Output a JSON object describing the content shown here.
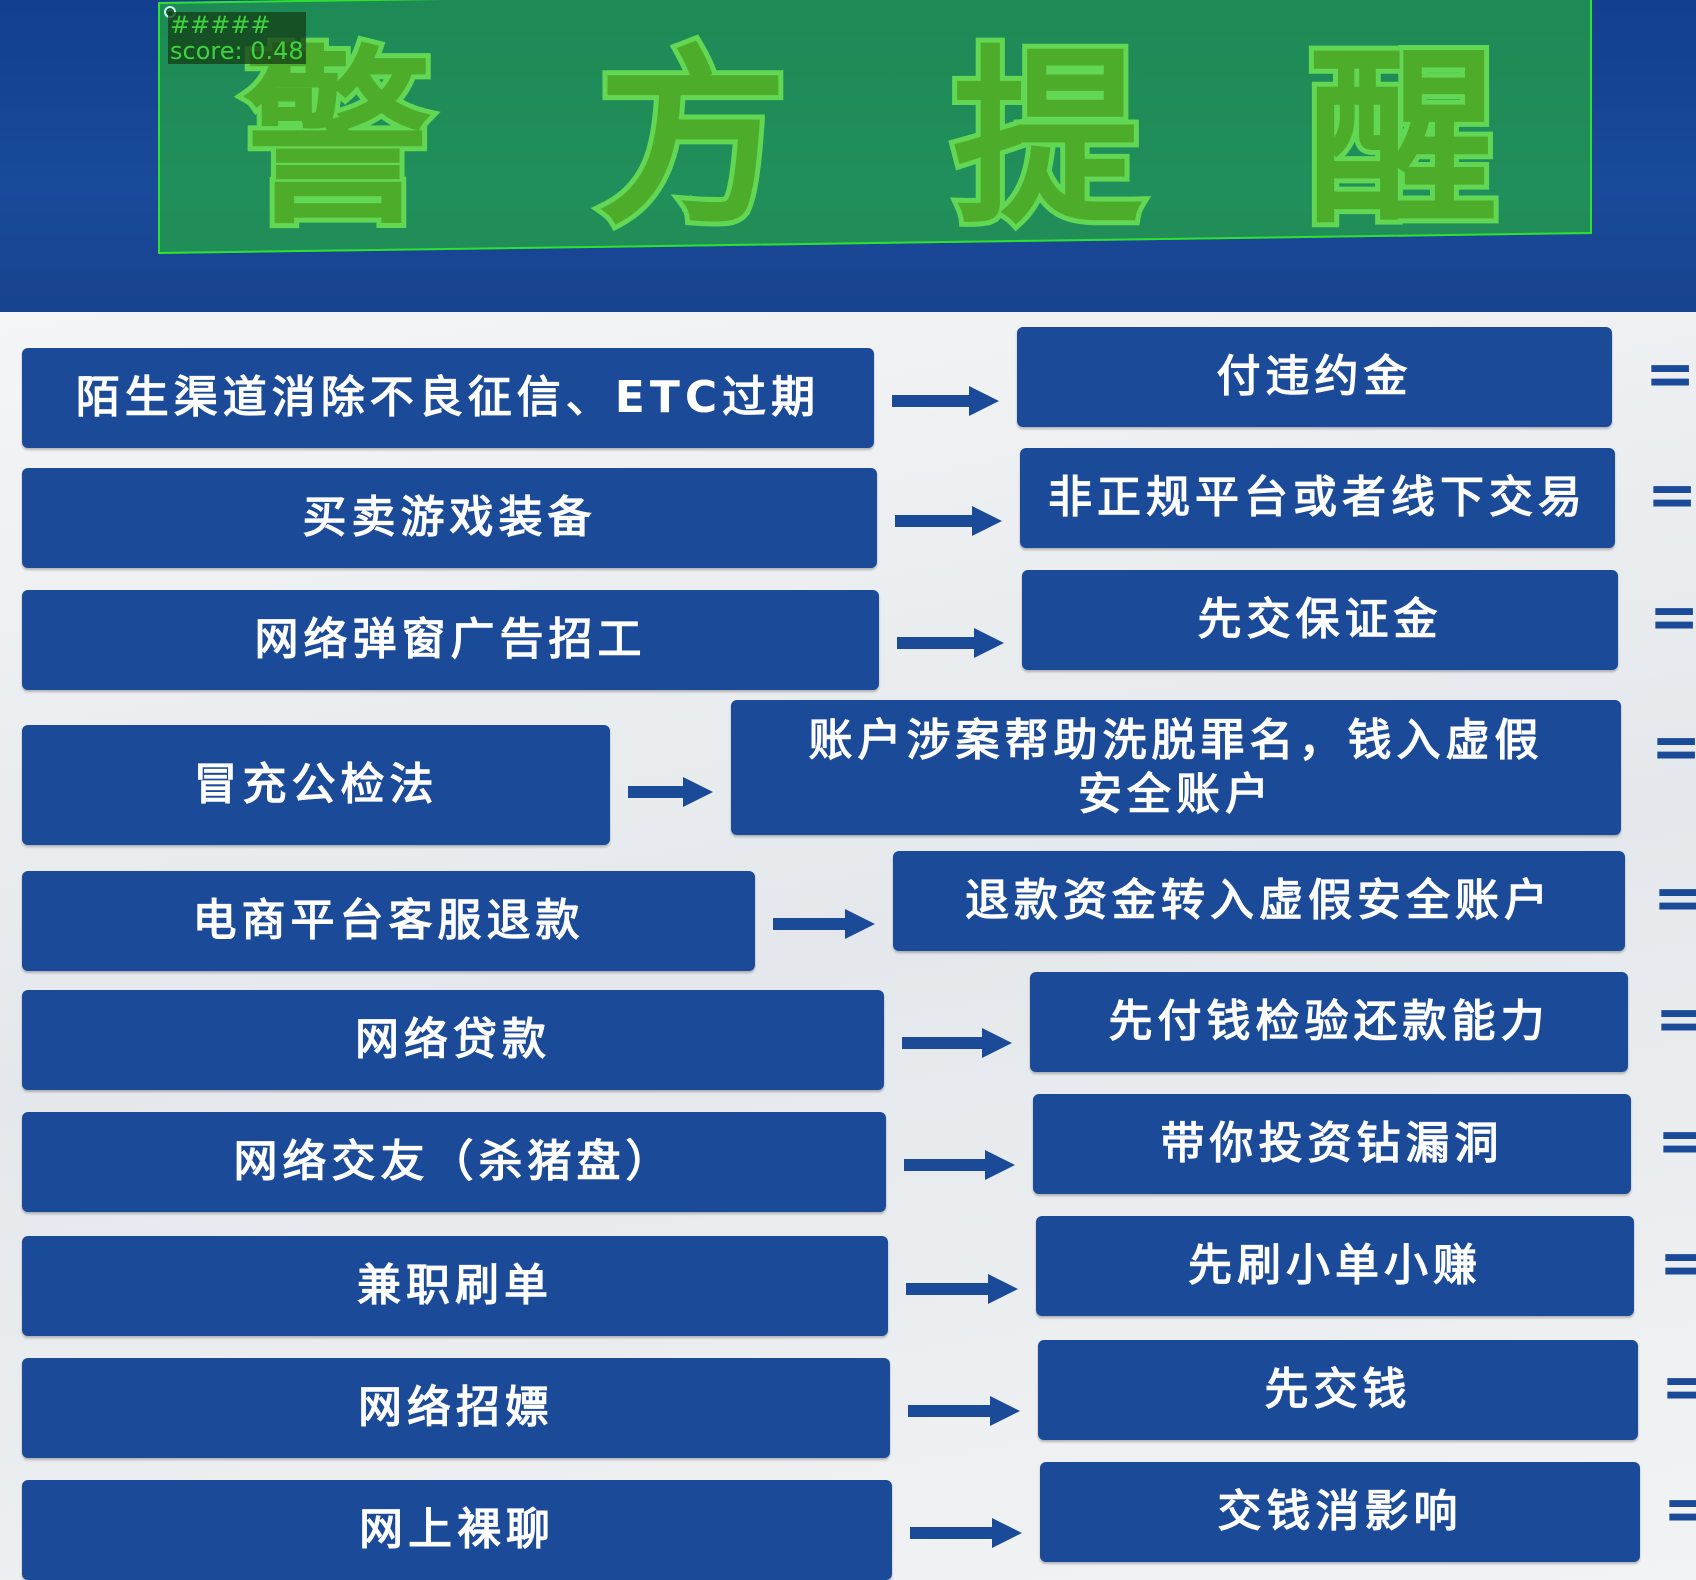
{
  "poster": {
    "title": [
      "警",
      "方",
      "提",
      "醒"
    ],
    "rows": [
      {
        "cause": "陌生渠道消除不良征信、ETC过期",
        "scam": "付违约金"
      },
      {
        "cause": "买卖游戏装备",
        "scam": "非正规平台或者线下交易"
      },
      {
        "cause": "网络弹窗广告招工",
        "scam": "先交保证金"
      },
      {
        "cause": "冒充公检法",
        "scam": "账户涉案帮助洗脱罪名，钱入虚假安全账户"
      },
      {
        "cause": "电商平台客服退款",
        "scam": "退款资金转入虚假安全账户"
      },
      {
        "cause": "网络贷款",
        "scam": "先付钱检验还款能力"
      },
      {
        "cause": "网络交友（杀猪盘）",
        "scam": "带你投资钻漏洞"
      },
      {
        "cause": "兼职刷单",
        "scam": "先刷小单小赚"
      },
      {
        "cause": "网络招嫖",
        "scam": "先交钱"
      },
      {
        "cause": "网上裸聊",
        "scam": "交钱消影响"
      }
    ],
    "equals_sign": "="
  },
  "detection": {
    "label": "#####",
    "score": "score: 0.48",
    "color": "#30e030"
  },
  "colors": {
    "blue": "#1b4a99",
    "header": "#123f8f"
  }
}
